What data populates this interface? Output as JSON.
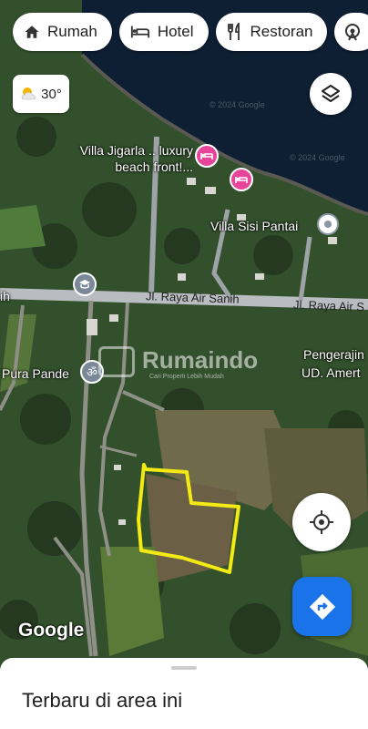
{
  "chips": [
    {
      "label": "Rumah",
      "icon": "home-icon"
    },
    {
      "label": "Hotel",
      "icon": "hotel-bed-icon"
    },
    {
      "label": "Restoran",
      "icon": "restaurant-icon"
    },
    {
      "label": "",
      "icon": "attractions-icon"
    }
  ],
  "weather": {
    "temp": "30°",
    "icon": "partly-sunny-icon"
  },
  "places": {
    "villa_jigarla": "Villa Jigarla .. luxury beach front!...",
    "villa_sisi": "Villa Sisi Pantai",
    "pura_pande": "Pura Pande",
    "pengerajin": "Pengerajin",
    "ud_amert": "UD. Amert",
    "road_left_fragment": "ih"
  },
  "roads": {
    "main": "Jl. Raya Air Sanih",
    "main_right": "Jl. Raya Air S"
  },
  "watermark": {
    "brand": "Rumaindo",
    "tagline": "Cari Properti Lebih Mudah"
  },
  "attribution": "Google",
  "sheet": {
    "title": "Terbaru di area ini"
  },
  "colors": {
    "accent": "#1a73e8",
    "hotel_pin": "#e8459a",
    "parcel_outline": "#f2ea12",
    "sea": "#0e1e33"
  }
}
